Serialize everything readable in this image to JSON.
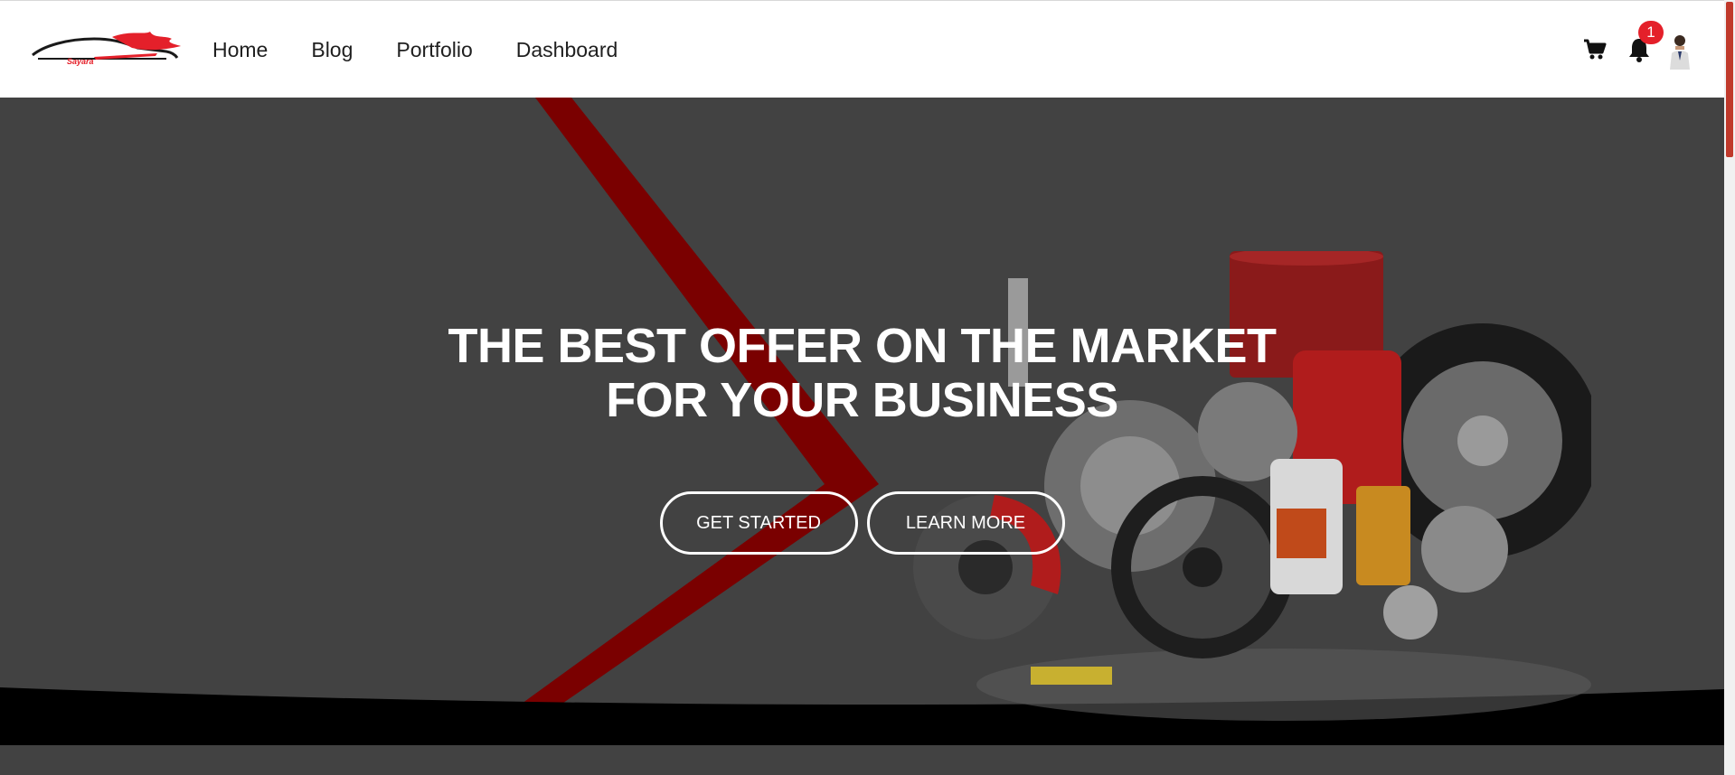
{
  "brand": {
    "logo_text": "Sayara",
    "accent": "#e4202a"
  },
  "nav": {
    "links": [
      "Home",
      "Blog",
      "Portfolio",
      "Dashboard"
    ]
  },
  "header_actions": {
    "cart_icon": "cart-icon",
    "bell_icon": "bell-icon",
    "notification_count": "1",
    "avatar": "user-avatar"
  },
  "hero": {
    "title_line1": "THE BEST OFFER ON THE MARKET",
    "title_line2": "FOR YOUR BUSINESS",
    "primary_button": "GET STARTED",
    "secondary_button": "LEARN MORE",
    "background": "#424242",
    "stripe_color": "#7a0000"
  }
}
